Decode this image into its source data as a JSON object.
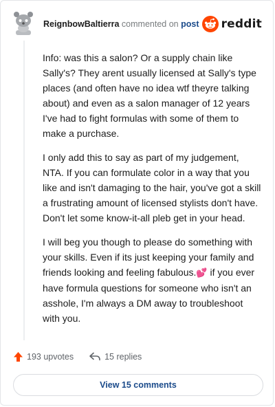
{
  "header": {
    "author": "ReignbowBaltierra",
    "action": "commented on",
    "target": "post",
    "brand": "reddit"
  },
  "comment": {
    "paragraphs": [
      "Info: was this a salon? Or a supply chain like Sally's? They arent usually licensed at Sally's type places (and often have no idea wtf theyre talking about) and even as a salon manager of 12 years I've had to fight formulas with some of them to make a purchase.",
      "I only add this to say as part of my judgement, NTA. If you can formulate color in a way that you like and isn't damaging to the hair, you've got a skill a frustrating amount of licensed stylists don't have. Don't let some know-it-all pleb get in your head.",
      "I will beg you though to please do something with your skills. Even if its just keeping your family and friends looking and feeling fabulous.",
      " if you ever have formula questions for someone who isn't an asshole, I'm always a DM away to troubleshoot with you."
    ],
    "emoji": "💕"
  },
  "footer": {
    "upvotes": "193 upvotes",
    "replies": "15 replies",
    "view_comments": "View 15 comments"
  },
  "icons": {
    "upvote": "upvote-arrow-icon",
    "reply": "reply-arrow-icon",
    "avatar": "snoo-avatar-icon",
    "logo": "reddit-alien-icon"
  },
  "colors": {
    "upvote": "#ff4500",
    "brand": "#ff4500",
    "link": "#1a4a8a",
    "muted": "#787c7e"
  }
}
